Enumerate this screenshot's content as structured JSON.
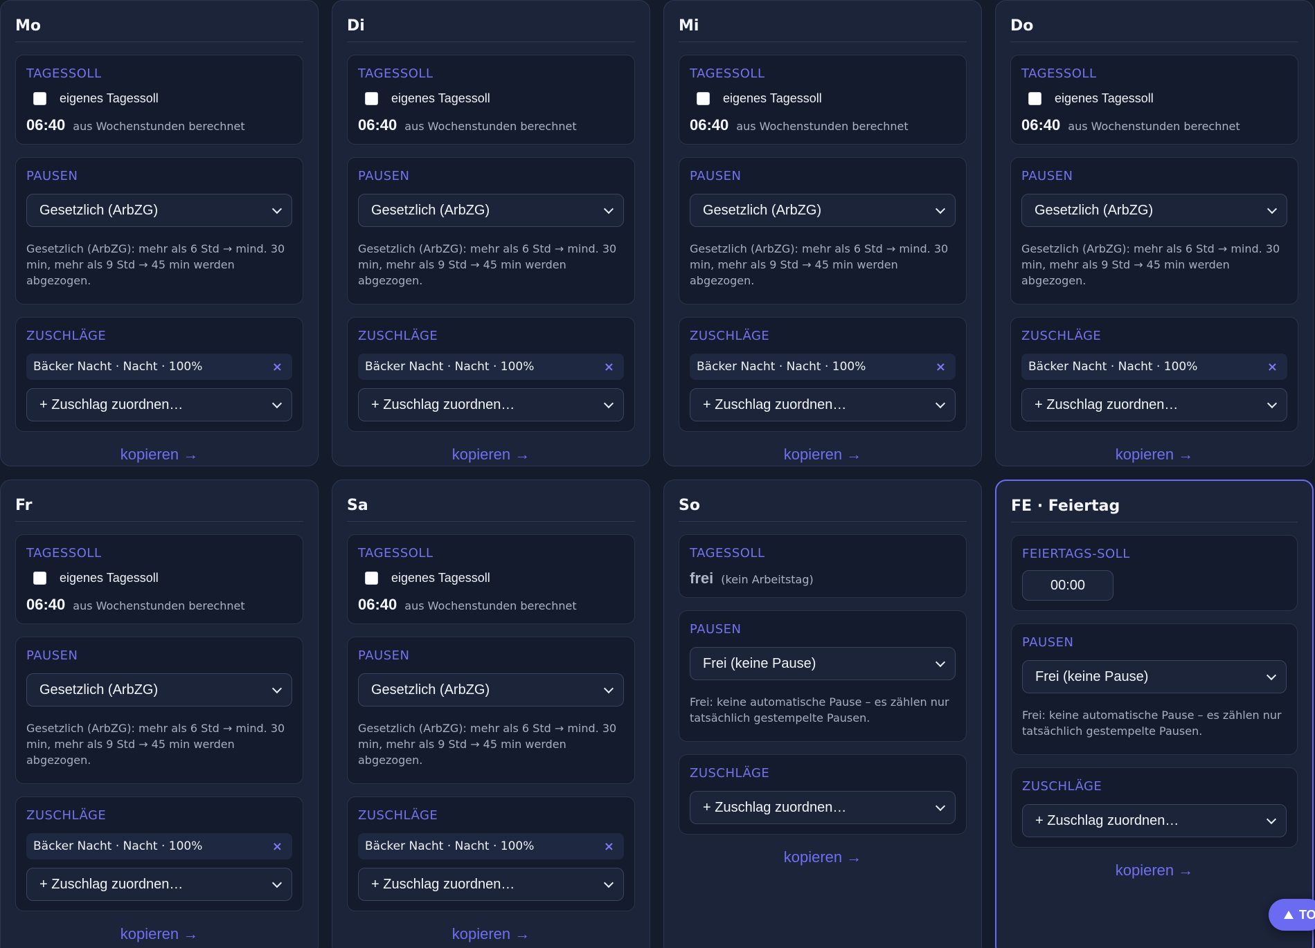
{
  "labels": {
    "tagessoll": "TAGESSOLL",
    "feiertagssoll": "FEIERTAGS-SOLL",
    "pausen": "PAUSEN",
    "zuschlaege": "ZUSCHLÄGE",
    "eigenes_tagessoll": "eigenes Tagessoll",
    "aus_wochenstunden": "aus Wochenstunden berechnet",
    "kopieren": "kopieren →",
    "zuschlag_zuordnen": "+ Zuschlag zuordnen…",
    "remove_x": "×",
    "top_button": "TO"
  },
  "options": {
    "gesetzlich": "Gesetzlich (ArbZG)",
    "frei": "Frei (keine Pause)"
  },
  "hints": {
    "gesetzlich": "Gesetzlich (ArbZG): mehr als 6 Std → mind. 30 min, mehr als 9 Std → 45 min werden abgezogen.",
    "frei": "Frei: keine automatische Pause – es zählen nur tatsächlich gestempelte Pausen."
  },
  "surcharge_chip": "Bäcker Nacht · Nacht · 100%",
  "days": {
    "mo": {
      "title": "Mo",
      "soll": "06:40"
    },
    "di": {
      "title": "Di",
      "soll": "06:40"
    },
    "mi": {
      "title": "Mi",
      "soll": "06:40"
    },
    "do": {
      "title": "Do",
      "soll": "06:40"
    },
    "fr": {
      "title": "Fr",
      "soll": "06:40"
    },
    "sa": {
      "title": "Sa",
      "soll": "06:40"
    },
    "so": {
      "title": "So",
      "soll": "frei",
      "soll_note": "(kein Arbeitstag)"
    },
    "fe": {
      "title": "FE · Feiertag",
      "soll_input": "00:00"
    }
  },
  "colors": {
    "accent": "#6b6bf2",
    "background": "#141b2b",
    "card": "#1b2438"
  }
}
